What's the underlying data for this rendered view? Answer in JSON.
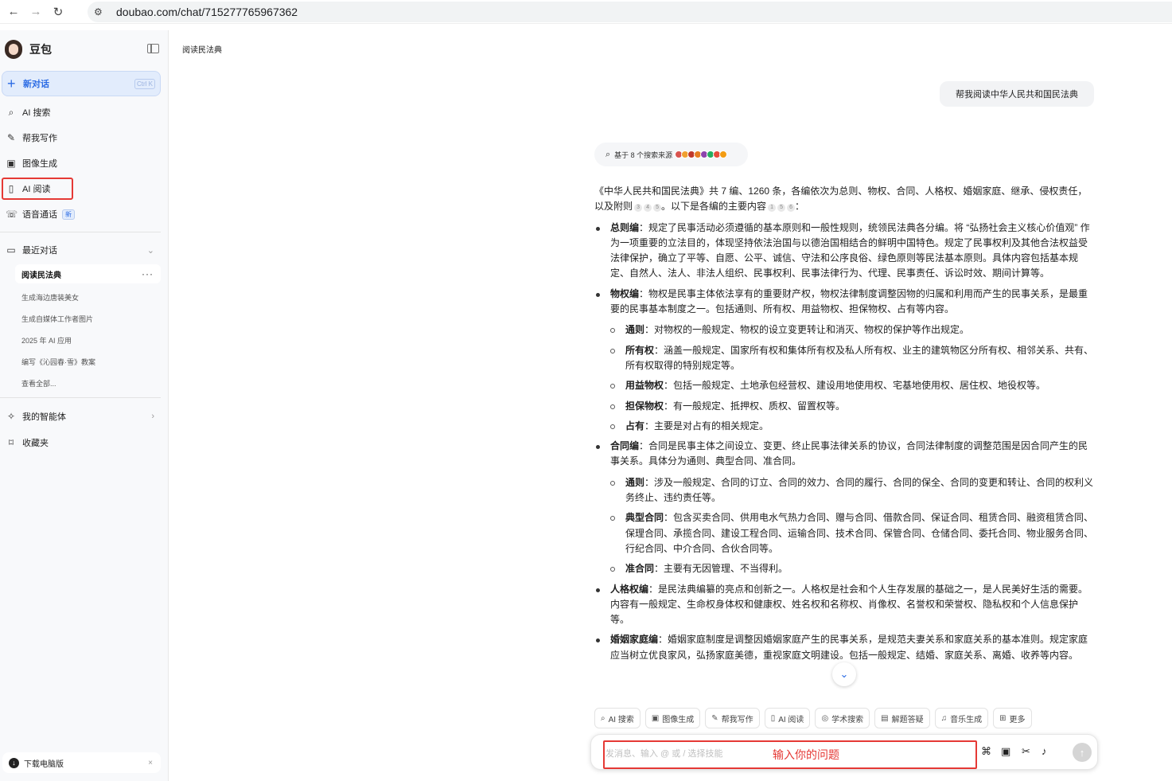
{
  "browser": {
    "back_icon": "←",
    "forward_icon": "→",
    "reload_icon": "↻",
    "url": "doubao.com/chat/715277765967362"
  },
  "sidebar": {
    "brand": "豆包",
    "new_chat": "新对话",
    "new_chat_shortcut": "Ctrl K",
    "nav": [
      {
        "icon": "⌕",
        "label": "AI 搜索"
      },
      {
        "icon": "✎",
        "label": "帮我写作"
      },
      {
        "icon": "▣",
        "label": "图像生成"
      },
      {
        "icon": "▯",
        "label": "AI 阅读"
      },
      {
        "icon": "☏",
        "label": "语音通话",
        "badge": "新"
      }
    ],
    "recent_title": "最近对话",
    "recent": [
      "阅读民法典",
      "生成海边唐装美女",
      "生成自媒体工作者图片",
      "2025 年 AI 应用",
      "编写《沁园春·雪》教案",
      "查看全部..."
    ],
    "agents": "我的智能体",
    "favorites": "收藏夹",
    "download": "下载电脑版"
  },
  "main": {
    "title": "阅读民法典",
    "user_message": "帮我阅读中华人民共和国民法典",
    "sources_label": "基于 8 个搜索来源",
    "source_colors": [
      "#d9534f",
      "#f0a030",
      "#c0392b",
      "#e67e22",
      "#8e44ad",
      "#27ae60",
      "#e74c3c",
      "#f39c12"
    ],
    "intro_a": "《中华人民共和国民法典》共 7 编、1260 条，各编依次为总则、物权、合同、人格权、婚姻家庭、继承、侵权责任，以及附则",
    "intro_b": "。以下是各编的主要内容",
    "intro_c": "：",
    "cites_1": [
      "3",
      "4",
      "5"
    ],
    "cites_2": [
      "1",
      "5",
      "6"
    ],
    "sections": {
      "zongze": {
        "title": "总则编",
        "text": "：规定了民事活动必须遵循的基本原则和一般性规则，统领民法典各分编。将 “弘扬社会主义核心价值观” 作为一项重要的立法目的，体现坚持依法治国与以德治国相结合的鲜明中国特色。规定了民事权利及其他合法权益受法律保护，确立了平等、自愿、公平、诚信、守法和公序良俗、绿色原则等民法基本原则。具体内容包括基本规定、自然人、法人、非法人组织、民事权利、民事法律行为、代理、民事责任、诉讼时效、期间计算等。"
      },
      "wuquan": {
        "title": "物权编",
        "text": "：物权是民事主体依法享有的重要财产权，物权法律制度调整因物的归属和利用而产生的民事关系，是最重要的民事基本制度之一。包括通则、所有权、用益物权、担保物权、占有等内容。",
        "items": [
          {
            "title": "通则",
            "text": "：对物权的一般规定、物权的设立变更转让和消灭、物权的保护等作出规定。"
          },
          {
            "title": "所有权",
            "text": "：涵盖一般规定、国家所有权和集体所有权及私人所有权、业主的建筑物区分所有权、相邻关系、共有、所有权取得的特别规定等。"
          },
          {
            "title": "用益物权",
            "text": "：包括一般规定、土地承包经营权、建设用地使用权、宅基地使用权、居住权、地役权等。"
          },
          {
            "title": "担保物权",
            "text": "：有一般规定、抵押权、质权、留置权等。"
          },
          {
            "title": "占有",
            "text": "：主要是对占有的相关规定。"
          }
        ]
      },
      "hetong": {
        "title": "合同编",
        "text": "：合同是民事主体之间设立、变更、终止民事法律关系的协议，合同法律制度的调整范围是因合同产生的民事关系。具体分为通则、典型合同、准合同。",
        "items": [
          {
            "title": "通则",
            "text": "：涉及一般规定、合同的订立、合同的效力、合同的履行、合同的保全、合同的变更和转让、合同的权利义务终止、违约责任等。"
          },
          {
            "title": "典型合同",
            "text": "：包含买卖合同、供用电水气热力合同、赠与合同、借款合同、保证合同、租赁合同、融资租赁合同、保理合同、承揽合同、建设工程合同、运输合同、技术合同、保管合同、仓储合同、委托合同、物业服务合同、行纪合同、中介合同、合伙合同等。"
          },
          {
            "title": "准合同",
            "text": "：主要有无因管理、不当得利。"
          }
        ]
      },
      "renge": {
        "title": "人格权编",
        "text": "：是民法典编纂的亮点和创新之一。人格权是社会和个人生存发展的基础之一，是人民美好生活的需要。内容有一般规定、生命权身体权和健康权、姓名权和名称权、肖像权、名誉权和荣誉权、隐私权和个人信息保护等。"
      },
      "hunyin": {
        "title": "婚姻家庭编",
        "text": "：婚姻家庭制度是调整因婚姻家庭产生的民事关系，是规范夫妻关系和家庭关系的基本准则。规定家庭应当树立优良家风，弘扬家庭美德，重视家庭文明建设。包括一般规定、结婚、家庭关系、离婚、收养等内容。"
      }
    },
    "skills": [
      {
        "icon": "⌕",
        "label": "AI 搜索"
      },
      {
        "icon": "▣",
        "label": "图像生成"
      },
      {
        "icon": "✎",
        "label": "帮我写作"
      },
      {
        "icon": "▯",
        "label": "AI 阅读"
      },
      {
        "icon": "◎",
        "label": "学术搜索"
      },
      {
        "icon": "▤",
        "label": "解题答疑"
      },
      {
        "icon": "♫",
        "label": "音乐生成"
      },
      {
        "icon": "⊞",
        "label": "更多"
      }
    ],
    "input_placeholder": "发消息、输入 @ 或 / 选择技能",
    "input_hint": "输入你的问题"
  }
}
